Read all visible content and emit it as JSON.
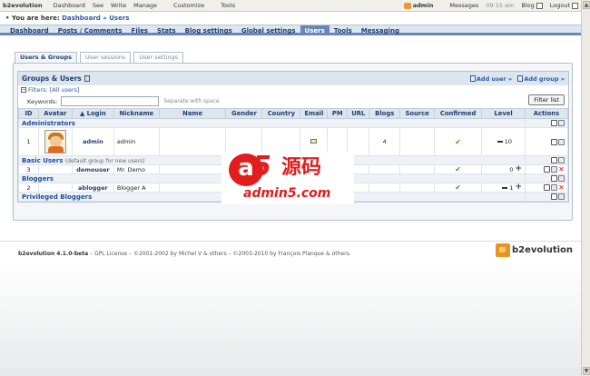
{
  "topbar": {
    "brand": "b2evolution",
    "menu": [
      "Dashboard",
      "See",
      "Write",
      "Manage",
      "Customize",
      "Tools"
    ],
    "user": "admin",
    "messages": "Messages",
    "time": "09:15 am",
    "blog": "Blog",
    "logout": "Logout"
  },
  "breadcrumb": {
    "prefix": "• You are here:",
    "dashboard": "Dashboard",
    "sep": "»",
    "current": "Users"
  },
  "tabs": [
    "Dashboard",
    "Posts / Comments",
    "Files",
    "Stats",
    "Blog settings",
    "Global settings",
    "Users",
    "Tools",
    "Messaging"
  ],
  "active_tab": "Users",
  "subtabs": [
    "Users & Groups",
    "User sessions",
    "User settings"
  ],
  "grid": {
    "title": "Groups & Users",
    "add_user": "Add user »",
    "add_group": "Add group »",
    "filters_label": "Filters:",
    "filters_value": "[All users]",
    "keywords_label": "Keywords:",
    "keywords_hint": "Separate with space",
    "filter_button": "Filter list",
    "columns": [
      "ID",
      "Avatar",
      "▲ Login",
      "Nickname",
      "Name",
      "Gender",
      "Country",
      "Email",
      "PM",
      "URL",
      "Blogs",
      "Source",
      "Confirmed",
      "Level",
      "Actions"
    ],
    "groups": [
      {
        "name": "Administrators",
        "note": "",
        "users": [
          {
            "id": "1",
            "login": "admin",
            "nickname": "admin",
            "blogs": "4",
            "confirmed": "✔",
            "level": "10",
            "email_icon": "mail-icon",
            "has_avatar": true
          }
        ]
      },
      {
        "name": "Basic Users",
        "note": "(default group for new users)",
        "users": [
          {
            "id": "3",
            "login": "demouser",
            "nickname": "Mr. Demo",
            "blogs": "",
            "confirmed": "✔",
            "level": "0"
          }
        ]
      },
      {
        "name": "Bloggers",
        "note": "",
        "users": [
          {
            "id": "2",
            "login": "ablogger",
            "nickname": "Blogger A",
            "blogs": "",
            "confirmed": "✔",
            "level": "1"
          }
        ]
      },
      {
        "name": "Privileged Bloggers",
        "note": "",
        "users": []
      }
    ]
  },
  "footer": {
    "product": "b2evolution 4.1.0-beta",
    "license": " – GPL License – ©2001-2002 by Michel V & others – ©2003-2010 by François Planque & others.",
    "logo": "b2evolution"
  },
  "watermark": {
    "mark": "a",
    "five": "5",
    "cn": "源码",
    "url": "admin5.com"
  },
  "colors": {
    "accent": "#6a86b8",
    "link": "#2b5aa8",
    "check": "#2ba51e",
    "delete": "#dd1111",
    "watermark": "#e11d1d"
  }
}
